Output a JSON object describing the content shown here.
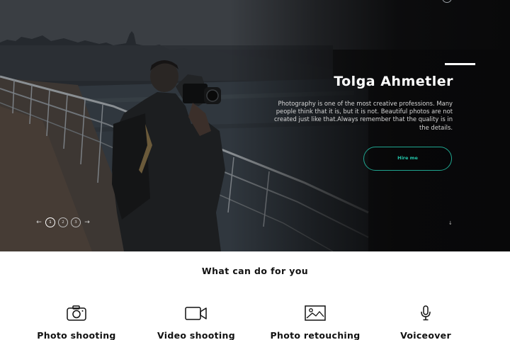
{
  "hero": {
    "name": "Tolga Ahmetler",
    "description": "Photography is one of the most creative professions. Many people think that it is, but it is not. Beautiful photos are not created just like that.Always remember that the quality is in the details.",
    "cta_label": "Hire me",
    "slider": {
      "prev_symbol": "←",
      "next_symbol": "→",
      "pages": [
        "1",
        "2",
        "3"
      ],
      "active_page": 1
    },
    "scroll_symbol": "↓"
  },
  "colors": {
    "accent": "#22c4a8",
    "hero_overlay": "#0f0f10",
    "text_dark": "#111111"
  },
  "services": {
    "title": "What can do for you",
    "items": [
      {
        "label": "Photo shooting",
        "icon": "camera-icon"
      },
      {
        "label": "Video shooting",
        "icon": "video-camera-icon"
      },
      {
        "label": "Photo retouching",
        "icon": "image-icon"
      },
      {
        "label": "Voiceover",
        "icon": "microphone-icon"
      }
    ]
  }
}
